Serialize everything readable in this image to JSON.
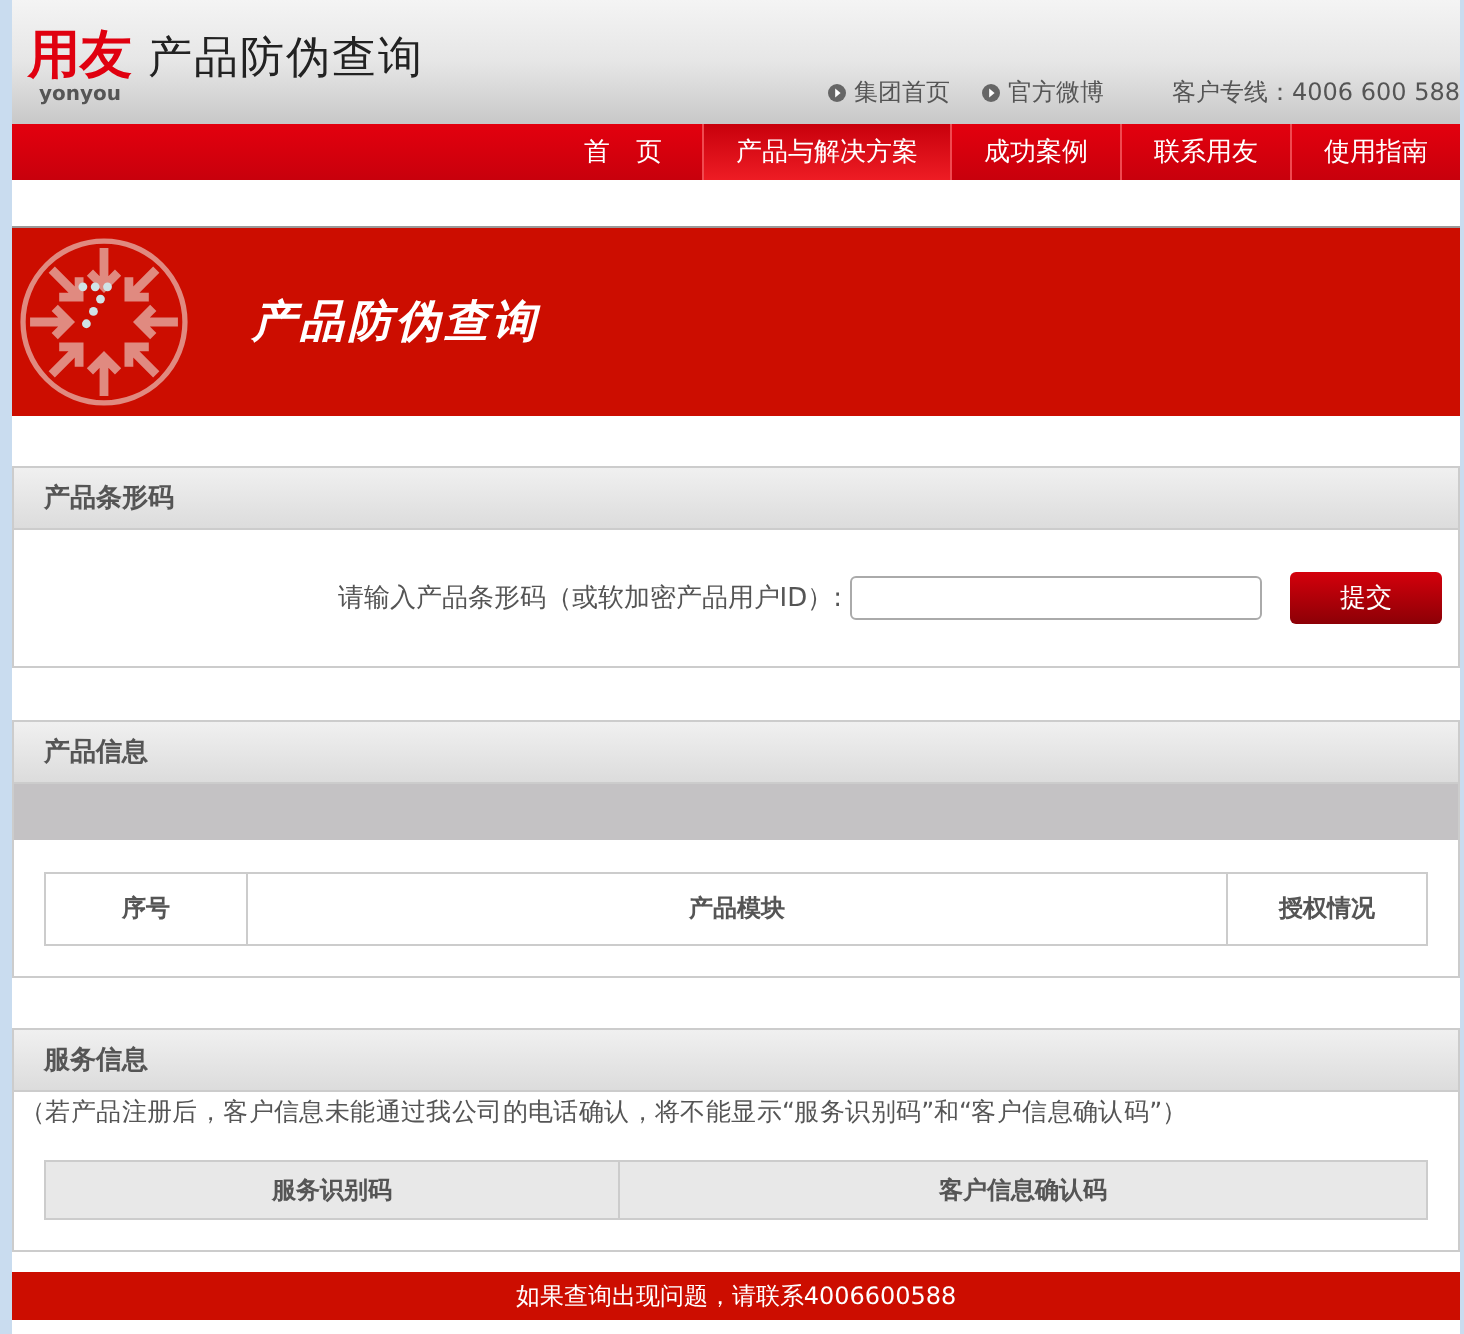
{
  "header": {
    "logo": "用友",
    "logo_sub": "yonyou",
    "title": "产品防伪查询",
    "links": [
      {
        "label": "集团首页"
      },
      {
        "label": "官方微博"
      }
    ],
    "hotline": "客户专线：4006 600 588"
  },
  "nav": [
    {
      "label": "首　页",
      "selected": false
    },
    {
      "label": "产品与解决方案",
      "selected": true
    },
    {
      "label": "成功案例",
      "selected": false
    },
    {
      "label": "联系用友",
      "selected": false
    },
    {
      "label": "使用指南",
      "selected": false
    }
  ],
  "banner": {
    "title": "产品防伪查询"
  },
  "barcode": {
    "heading": "产品条形码",
    "label": "请输入产品条形码（或软加密产品用户ID）:",
    "submit": "提交"
  },
  "product_info": {
    "heading": "产品信息",
    "columns": [
      "序号",
      "产品模块",
      "授权情况"
    ]
  },
  "service_info": {
    "heading": "服务信息",
    "note": "（若产品注册后，客户信息未能通过我公司的电话确认，将不能显示“服务识别码”和“客户信息确认码”）",
    "columns": [
      "服务识别码",
      "客户信息确认码"
    ]
  },
  "footer": "如果查询出现问题，请联系4006600588"
}
